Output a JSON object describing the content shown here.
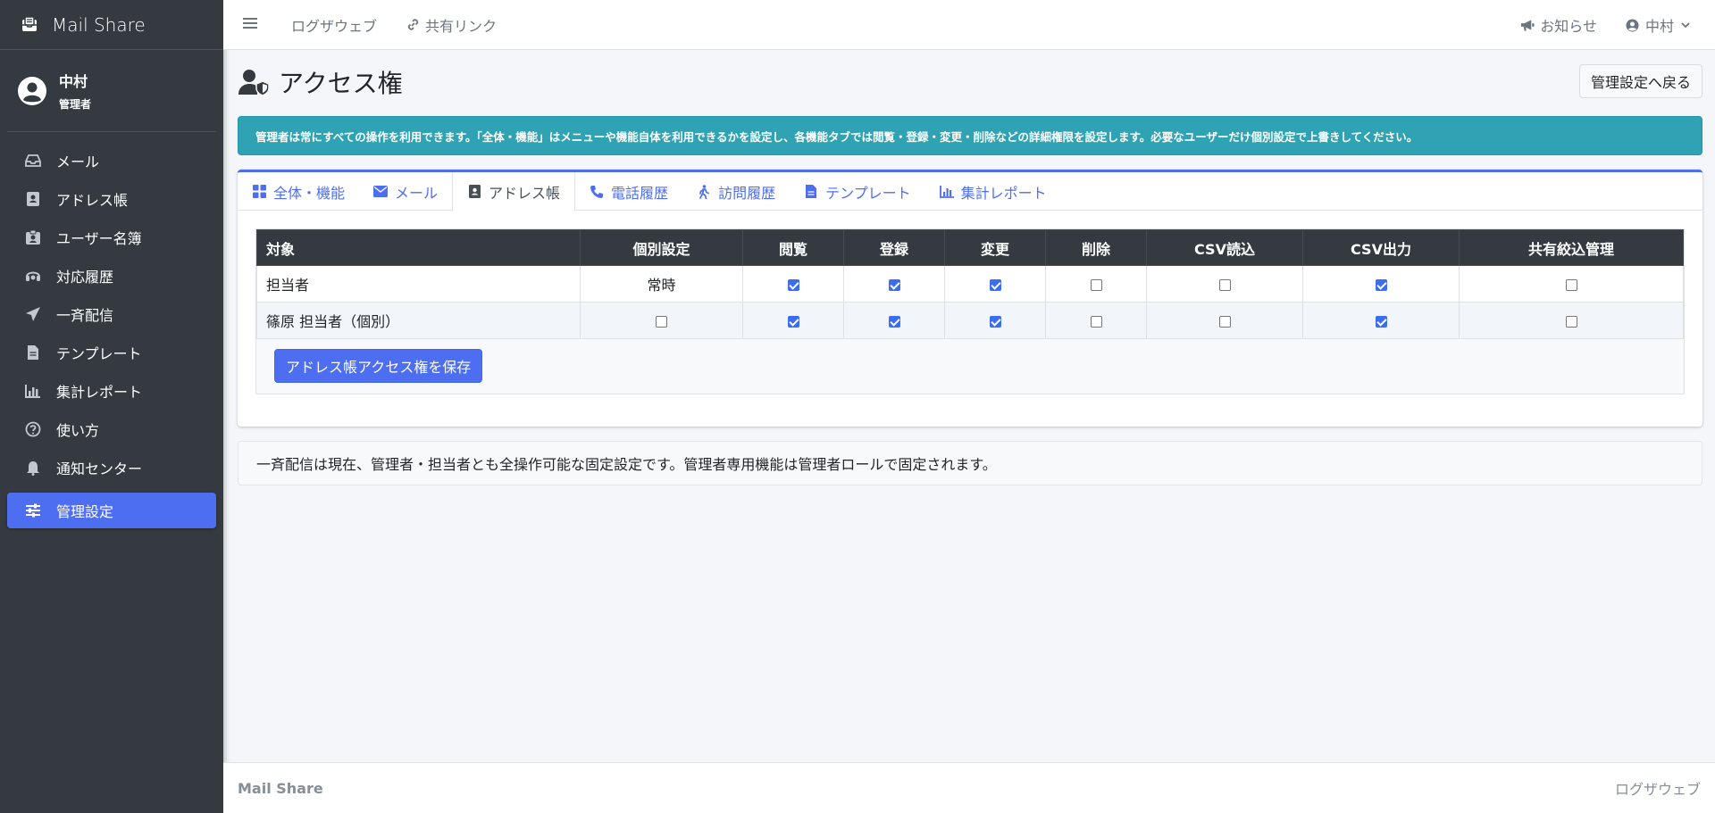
{
  "app": {
    "brand": "Mail Share"
  },
  "user": {
    "name": "中村",
    "role": "管理者"
  },
  "sidebar": {
    "items": [
      {
        "label": "メール",
        "icon": "inbox-icon"
      },
      {
        "label": "アドレス帳",
        "icon": "address-book-icon"
      },
      {
        "label": "ユーザー名簿",
        "icon": "id-badge-icon"
      },
      {
        "label": "対応履歴",
        "icon": "headset-icon"
      },
      {
        "label": "一斉配信",
        "icon": "paper-plane-icon"
      },
      {
        "label": "テンプレート",
        "icon": "file-icon"
      },
      {
        "label": "集計レポート",
        "icon": "chart-icon"
      },
      {
        "label": "使い方",
        "icon": "question-icon"
      },
      {
        "label": "通知センター",
        "icon": "bell-icon"
      },
      {
        "label": "管理設定",
        "icon": "sliders-icon",
        "active": true
      }
    ]
  },
  "topbar": {
    "link1": "ログザウェブ",
    "link2": "共有リンク",
    "notice": "お知らせ",
    "user": "中村"
  },
  "page": {
    "title": "アクセス権",
    "back_button": "管理設定へ戻る",
    "alert": "管理者は常にすべての操作を利用できます。「全体・機能」はメニューや機能自体を利用できるかを設定し、各機能タブでは閲覧・登録・変更・削除などの詳細権限を設定します。必要なユーザーだけ個別設定で上書きしてください。"
  },
  "tabs": [
    {
      "label": "全体・機能",
      "icon": "grid-icon"
    },
    {
      "label": "メール",
      "icon": "envelope-icon"
    },
    {
      "label": "アドレス帳",
      "icon": "address-book-icon",
      "active": true
    },
    {
      "label": "電話履歴",
      "icon": "phone-icon"
    },
    {
      "label": "訪問履歴",
      "icon": "walking-icon"
    },
    {
      "label": "テンプレート",
      "icon": "file-icon"
    },
    {
      "label": "集計レポート",
      "icon": "chart-icon"
    }
  ],
  "table": {
    "headers": [
      "対象",
      "個別設定",
      "閲覧",
      "登録",
      "変更",
      "削除",
      "CSV読込",
      "CSV出力",
      "共有絞込管理"
    ],
    "rows": [
      {
        "target": "担当者",
        "individual": "常時",
        "perms": [
          true,
          true,
          true,
          false,
          false,
          true,
          false
        ]
      },
      {
        "target": "篠原 担当者（個別）",
        "individual": false,
        "perms": [
          true,
          true,
          true,
          false,
          false,
          true,
          false
        ]
      }
    ]
  },
  "save_button": "アドレス帳アクセス権を保存",
  "note": "一斉配信は現在、管理者・担当者とも全操作可能な固定設定です。管理者専用機能は管理者ロールで固定されます。",
  "footer": {
    "brand": "Mail Share",
    "link": "ログザウェブ"
  },
  "colors": {
    "accent": "#4e6ef2",
    "sidebar": "#343a40",
    "alert": "#2fa3b4"
  }
}
